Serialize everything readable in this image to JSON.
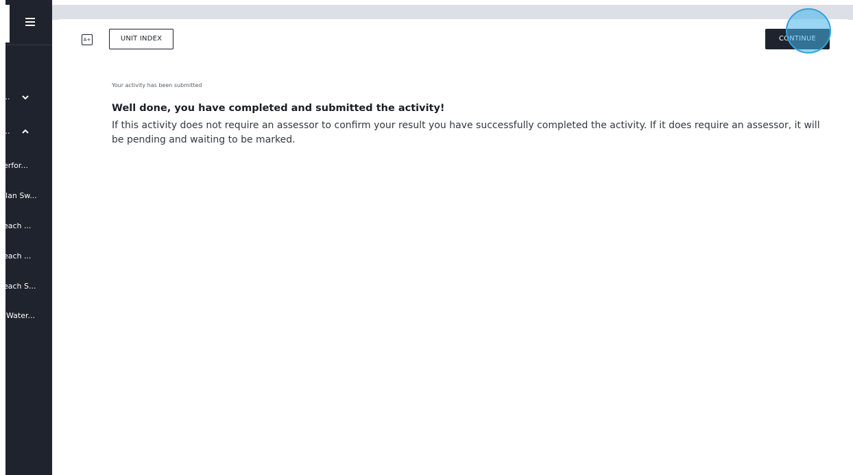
{
  "sidebar": {
    "menu_icon": "hamburger-menu-icon",
    "items": [
      {
        "label": "...",
        "icon": "chevron-down-icon"
      },
      {
        "label": "...",
        "icon": "chevron-up-icon"
      },
      {
        "label": "erfor..."
      },
      {
        "label": "llan Sw..."
      },
      {
        "label": "each ..."
      },
      {
        "label": "each ..."
      },
      {
        "label": "each S..."
      },
      {
        "label": "Water..."
      }
    ]
  },
  "toolbar": {
    "font_size_label": "A+",
    "unit_index_label": "UNIT INDEX",
    "continue_label": "CONTINUE"
  },
  "content": {
    "status_note": "Your activity has been submitted",
    "heading": "Well done, you have completed and submitted the activity!",
    "body": "If this activity does not require an assessor to confirm your result you have successfully completed the activity. If it does require an assessor, it will be pending and waiting to be marked."
  },
  "colors": {
    "sidebar_bg": "#1f232d",
    "continue_bg": "#1f232d",
    "topbar_bg": "#dcdfe5",
    "highlight": "#2ea3df"
  }
}
